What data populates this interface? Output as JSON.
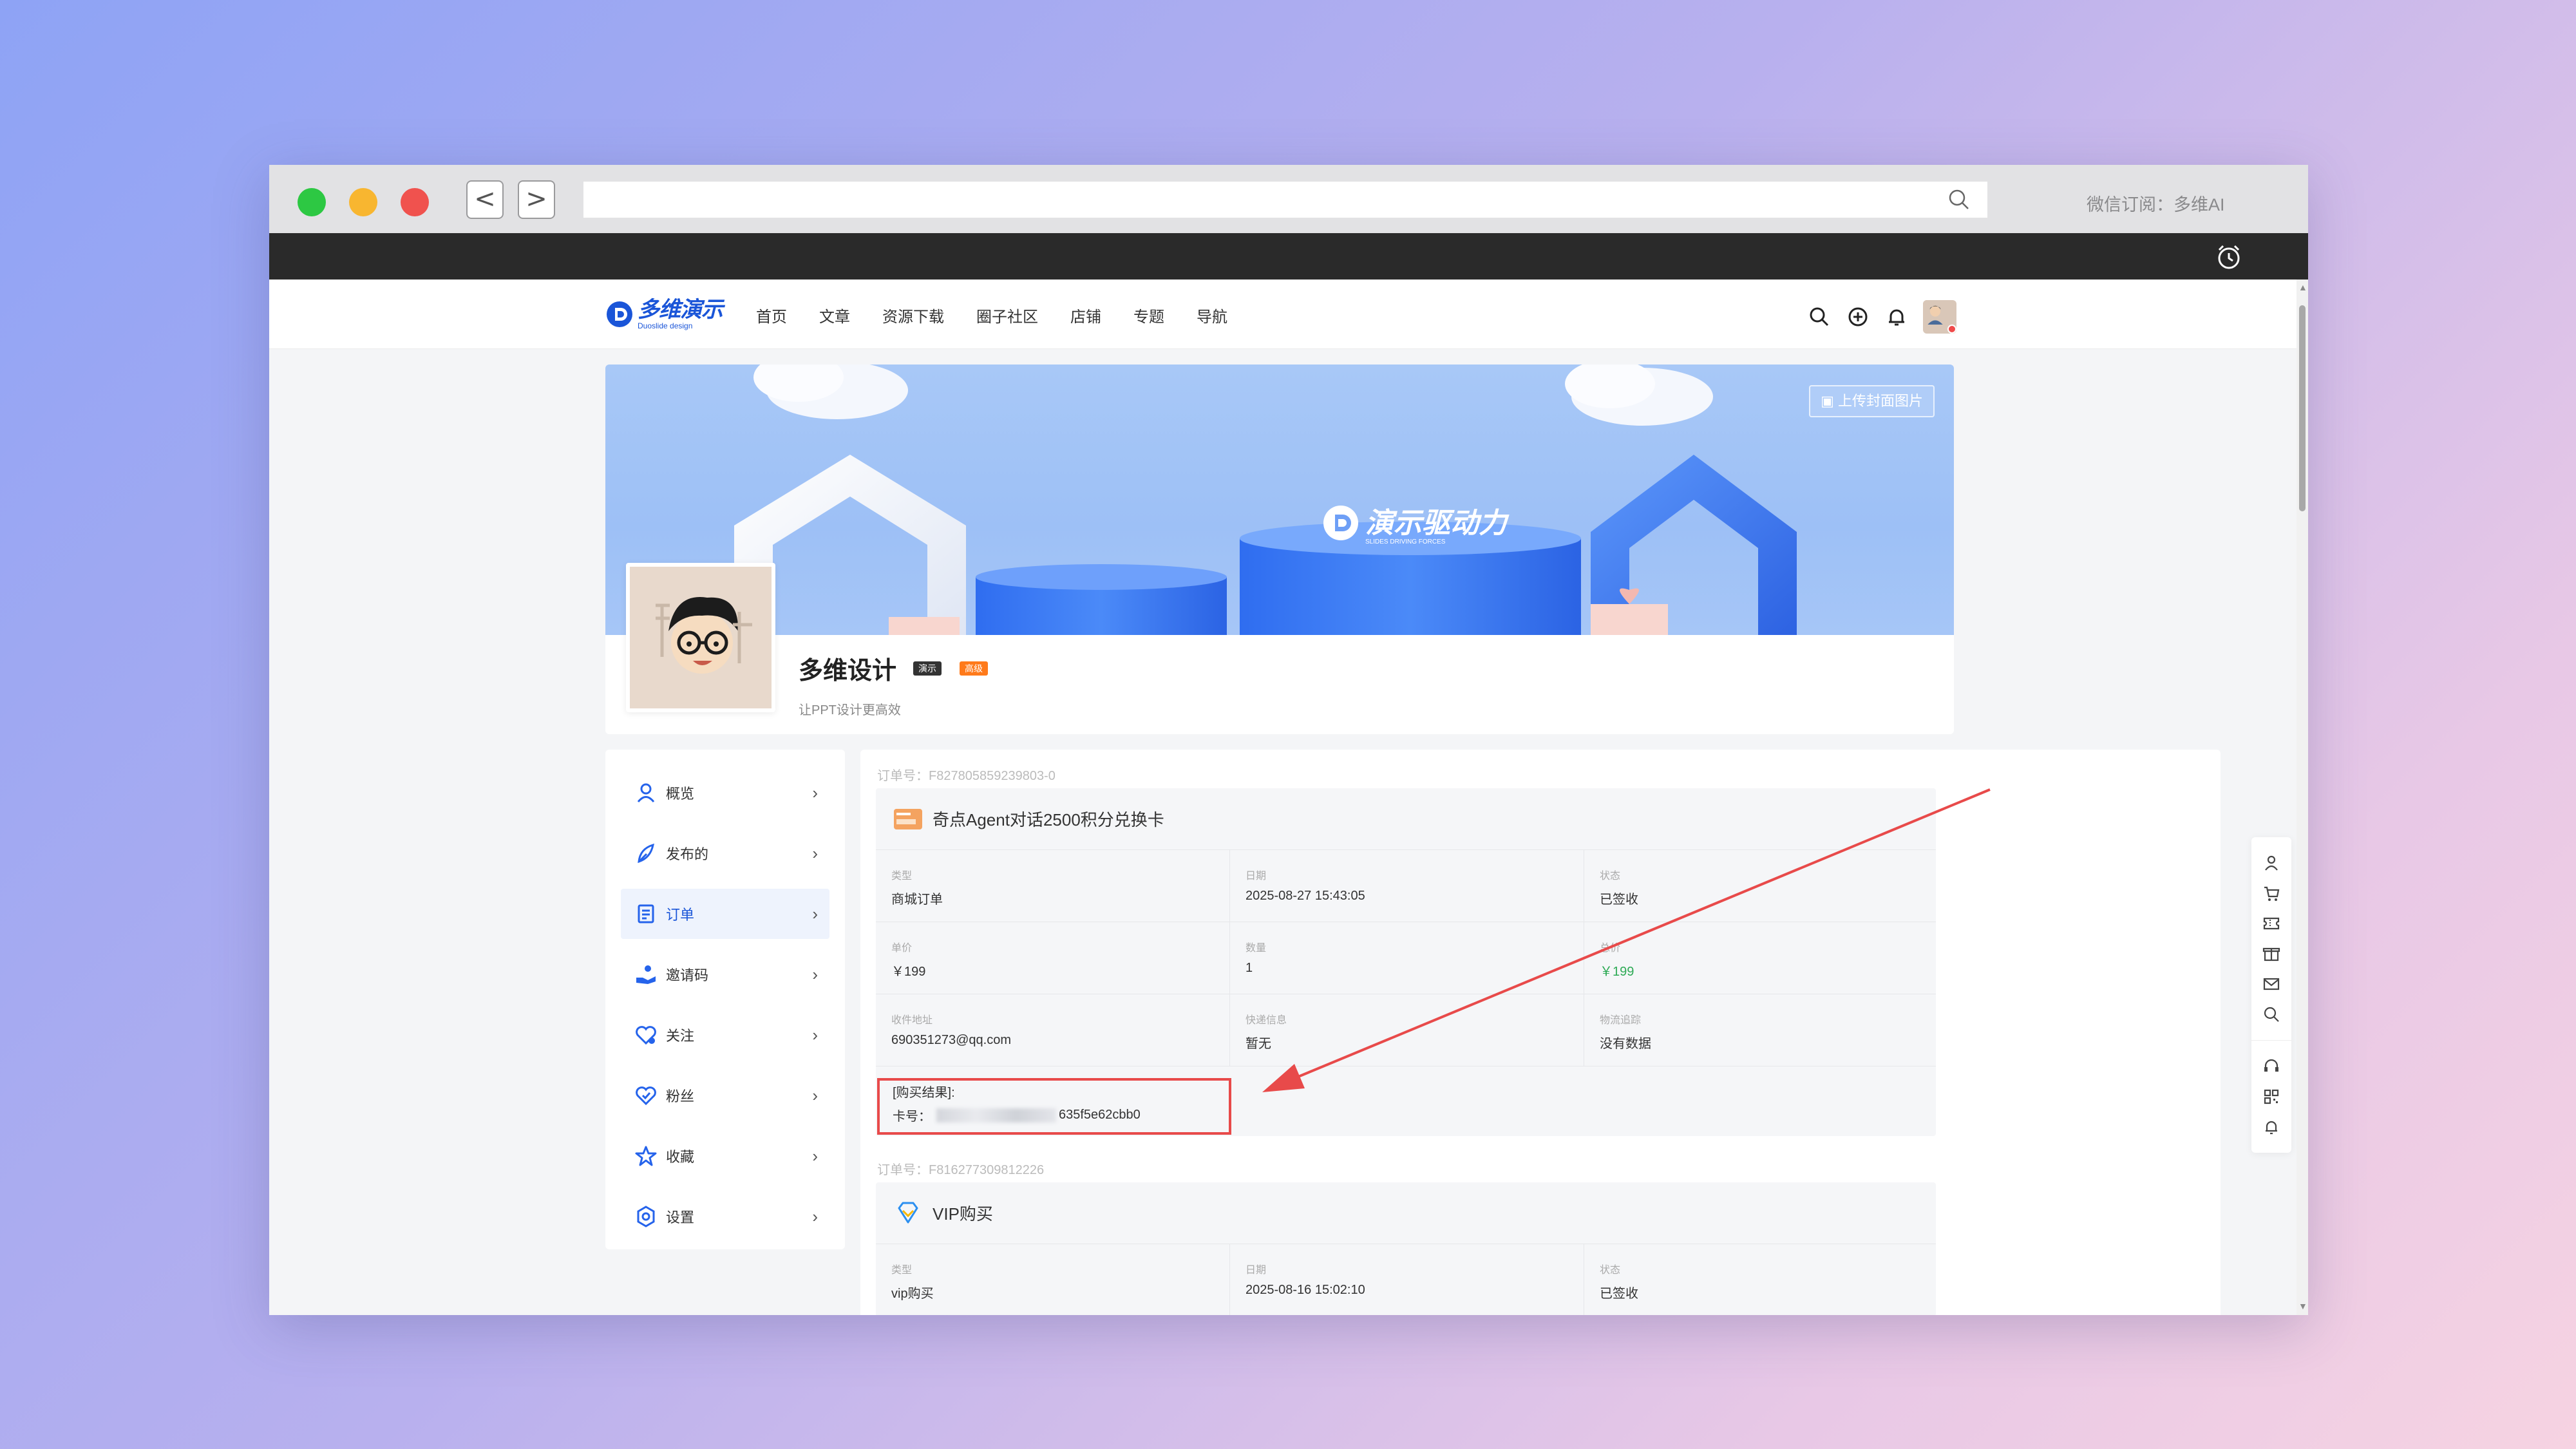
{
  "browser": {
    "url": "",
    "wechat_label": "微信订阅：多维AI"
  },
  "site": {
    "logo_text": "多维演示",
    "logo_sub": "Duoslide design",
    "nav": [
      "首页",
      "文章",
      "资源下载",
      "圈子社区",
      "店铺",
      "专题",
      "导航"
    ]
  },
  "profile": {
    "banner_brand": "演示驱动力",
    "banner_brand_en": "SLIDES DRIVING FORCES",
    "upload_label": "上传封面图片",
    "name": "多维设计",
    "badge1": "演示",
    "badge2": "高级",
    "subtitle": "让PPT设计更高效"
  },
  "sidebar": {
    "items": [
      {
        "label": "概览",
        "icon": "user-icon"
      },
      {
        "label": "发布的",
        "icon": "feather-icon"
      },
      {
        "label": "订单",
        "icon": "order-icon"
      },
      {
        "label": "邀请码",
        "icon": "invite-icon"
      },
      {
        "label": "关注",
        "icon": "follow-icon"
      },
      {
        "label": "粉丝",
        "icon": "fans-icon"
      },
      {
        "label": "收藏",
        "icon": "star-icon"
      },
      {
        "label": "设置",
        "icon": "gear-icon"
      }
    ],
    "active_index": 2
  },
  "orders": [
    {
      "order_no": "订单号：F827805859239803-0",
      "title": "奇点Agent对话2500积分兑换卡",
      "rows": [
        [
          {
            "k": "类型",
            "v": "商城订单"
          },
          {
            "k": "日期",
            "v": "2025-08-27 15:43:05"
          },
          {
            "k": "状态",
            "v": "已签收"
          }
        ],
        [
          {
            "k": "单价",
            "v": "￥199"
          },
          {
            "k": "数量",
            "v": "1"
          },
          {
            "k": "总价",
            "v": "￥199"
          }
        ],
        [
          {
            "k": "收件地址",
            "v": "690351273@qq.com"
          },
          {
            "k": "快递信息",
            "v": "暂无"
          },
          {
            "k": "物流追踪",
            "v": "没有数据"
          }
        ]
      ],
      "result_title": "[购买结果]:",
      "result_card_prefix": "卡号：",
      "result_card_suffix": "635f5e62cbb0"
    },
    {
      "order_no": "订单号：F816277309812226",
      "title": "VIP购买",
      "rows": [
        [
          {
            "k": "类型",
            "v": "vip购买"
          },
          {
            "k": "日期",
            "v": "2025-08-16 15:02:10"
          },
          {
            "k": "状态",
            "v": "已签收"
          }
        ]
      ]
    }
  ],
  "colors": {
    "brand_blue": "#1a55d8",
    "annotation_red": "#e84a4a",
    "price_green": "#2eaa56"
  }
}
